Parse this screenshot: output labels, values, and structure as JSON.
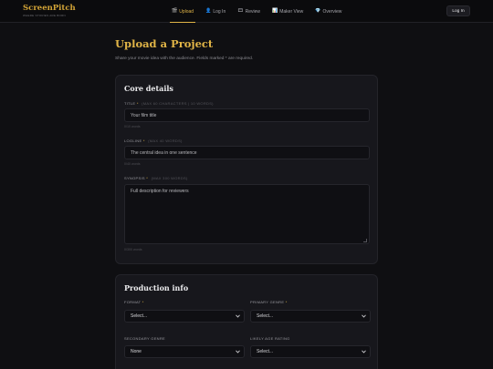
{
  "brand": {
    "name": "ScreenPitch",
    "tagline": "WHERE STORIES ARE BORN"
  },
  "nav": [
    {
      "icon": "🎬",
      "label": "Upload"
    },
    {
      "icon": "👤",
      "label": "Log In"
    },
    {
      "icon": "🎞",
      "label": "Review"
    },
    {
      "icon": "📊",
      "label": "Maker View"
    },
    {
      "icon": "💎",
      "label": "Overview"
    }
  ],
  "header": {
    "login_label": "Log In"
  },
  "page": {
    "title": "Upload a Project",
    "subtitle": "Share your movie idea with the audience. Fields marked * are required."
  },
  "core": {
    "title": "Core details",
    "title_field": {
      "label": "TITLE",
      "required": "*",
      "hint": "(MAX 60 CHARACTERS | 10 WORDS)",
      "placeholder": "Your film title",
      "counter": "0/10 words"
    },
    "logline_field": {
      "label": "LOGLINE",
      "required": "*",
      "hint": "(MAX 40 WORDS)",
      "placeholder": "The central idea in one sentence",
      "counter": "0/40 words"
    },
    "synopsis_field": {
      "label": "SYNOPSIS",
      "required": "*",
      "hint": "(MAX 300 WORDS)",
      "placeholder": "Full description for reviewers",
      "counter": "0/300 words"
    }
  },
  "production": {
    "title": "Production info",
    "format": {
      "label": "FORMAT",
      "required": "*",
      "value": "Select..."
    },
    "primary_genre": {
      "label": "PRIMARY GENRE",
      "required": "*",
      "value": "Select..."
    },
    "secondary_genre": {
      "label": "SECONDARY GENRE",
      "value": "None"
    },
    "age_rating": {
      "label": "LIKELY AGE RATING",
      "value": "Select..."
    }
  },
  "colors": {
    "accent": "#e0b447",
    "background": "#0f0f12",
    "card": "#17171c"
  }
}
